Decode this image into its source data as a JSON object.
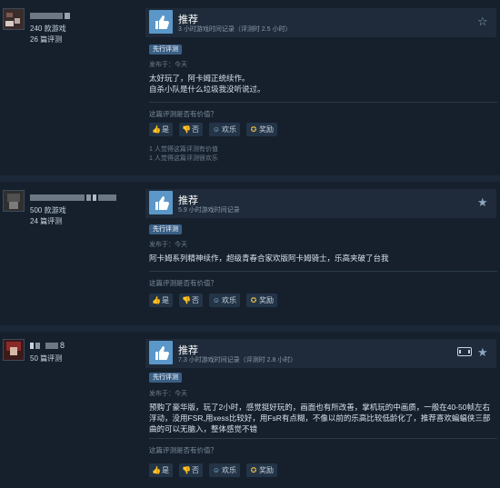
{
  "reviews": [
    {
      "username": "",
      "games": "240 款游戏",
      "reviews_count": "26 篇评测",
      "recommendation": "推荐",
      "hours": "3 小时游戏时间记录（评测时 2.5 小时）",
      "early_access": "先行评测",
      "posted": "发布于：今天",
      "content": [
        "太好玩了，阿卡姆正统续作。",
        "自杀小队是什么垃圾我没听说过。"
      ],
      "helpful_question": "这篇评测是否有价值？",
      "buttons": {
        "yes": "是",
        "no": "否",
        "funny": "欢乐",
        "award": "奖励"
      },
      "found_helpful": [
        "1 人觉得这篇评测有价值",
        "1 人觉得这篇评测很欢乐"
      ],
      "starred": false
    },
    {
      "username": "",
      "games": "500 款游戏",
      "reviews_count": "24 篇评测",
      "recommendation": "推荐",
      "hours": "5.9 小时游戏时间记录",
      "early_access": "先行评测",
      "posted": "发布于：今天",
      "content": [
        "阿卡姆系列精神续作，超级青春合家欢版阿卡姆骑士，乐高夹破了台我"
      ],
      "helpful_question": "这篇评测是否有价值？",
      "buttons": {
        "yes": "是",
        "no": "否",
        "funny": "欢乐",
        "award": "奖励"
      },
      "starred": true
    },
    {
      "username": "8",
      "games": "",
      "reviews_count": "50 篇评测",
      "recommendation": "推荐",
      "hours": "7.3 小时游戏时间记录（评测时 2.8 小时）",
      "early_access": "先行评测",
      "posted": "发布于：今天",
      "content": [
        "预购了豪华版，玩了2小时，感觉挺好玩的，画面也有所改善，掌机玩的中画质，一般在40-50帧左右浮动，没用FSR,用xess比较好，用FsR有点糊，不像以前的乐高比较低龄化了，推荐喜欢蝙蝠侠三部曲的可以无脑入，整体感觉不错"
      ],
      "helpful_question": "这篇评测是否有价值？",
      "buttons": {
        "yes": "是",
        "no": "否",
        "funny": "欢乐",
        "award": "奖励"
      },
      "starred": true,
      "steam_deck": true
    }
  ],
  "icons": {
    "thumb_up": "thumbs-up-icon",
    "thumb_down": "thumbs-down-icon",
    "funny": "smiley-icon",
    "award": "award-icon",
    "star": "star-icon",
    "deck": "steam-deck-icon"
  },
  "colors": {
    "background": "#1b2838",
    "card": "#16202d",
    "recommend_box": "#1f2b3a",
    "thumb": "#5b97c9",
    "early_access": "#3a5f86"
  }
}
